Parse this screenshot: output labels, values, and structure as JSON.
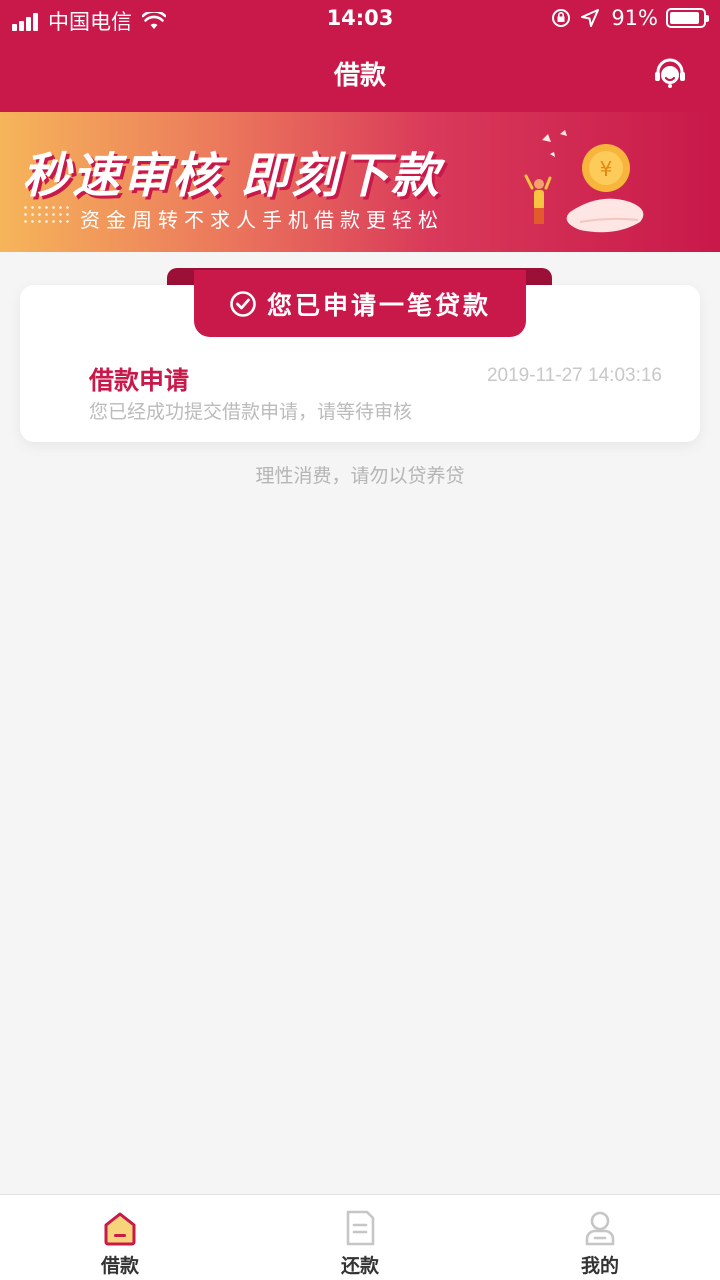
{
  "status_bar": {
    "carrier": "中国电信",
    "time": "14:03",
    "battery": "91%",
    "battery_level": 0.91
  },
  "nav": {
    "title": "借款",
    "service_icon": "customer-service-icon"
  },
  "banner": {
    "title": "秒速审核  即刻下款",
    "subtitle": "资金周转不求人手机借款更轻松"
  },
  "application_card": {
    "ribbon_text": "您已申请一笔贷款",
    "title": "借款申请",
    "time": "2019-11-27 14:03:16",
    "description": "您已经成功提交借款申请，请等待审核"
  },
  "hint": "理性消费，请勿以贷养贷",
  "tabbar": {
    "tabs": [
      {
        "label": "借款",
        "icon": "home-icon",
        "active": true
      },
      {
        "label": "还款",
        "icon": "document-icon",
        "active": false
      },
      {
        "label": "我的",
        "icon": "user-icon",
        "active": false
      }
    ]
  },
  "colors": {
    "accent": "#c8194a",
    "background": "#f5f5f5"
  }
}
